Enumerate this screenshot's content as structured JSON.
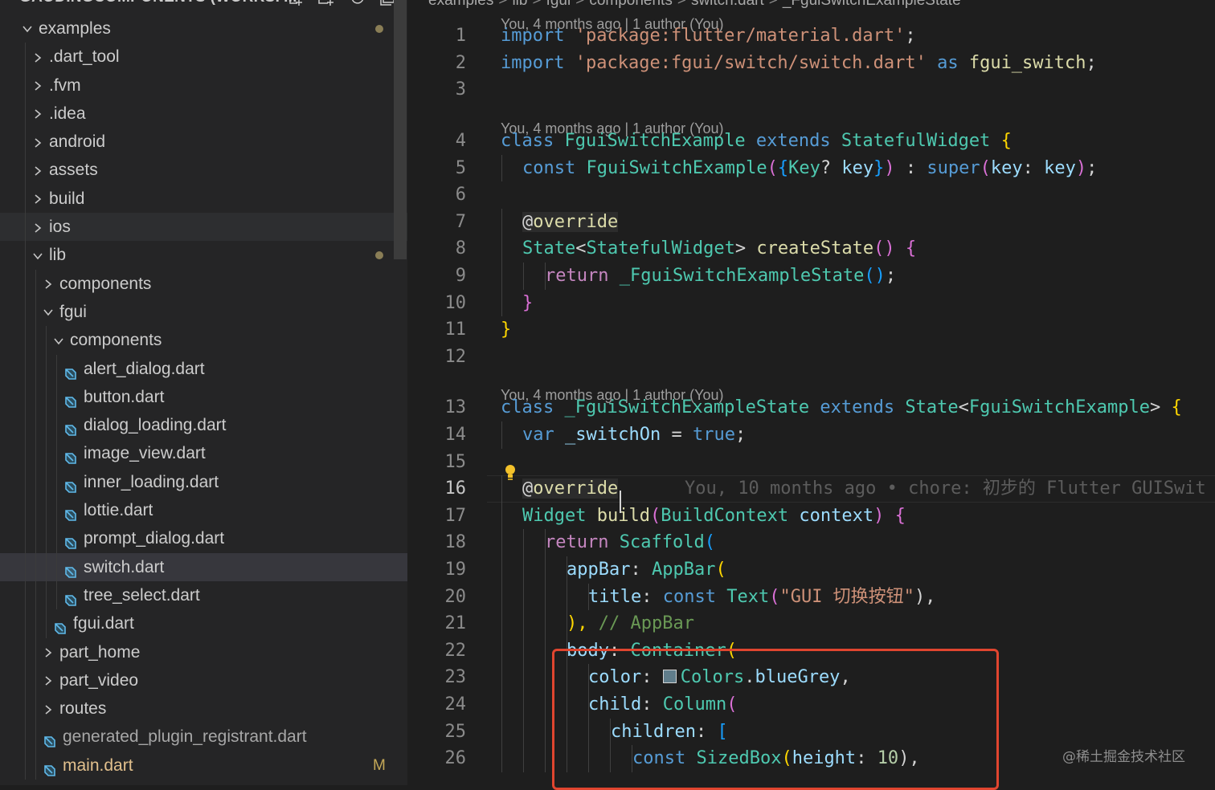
{
  "explorer": {
    "title": "GAODINGCOMPONENTS (WORKSP...",
    "header_icons": [
      "new-file-icon",
      "new-folder-icon",
      "refresh-icon",
      "collapse-all-icon"
    ],
    "tree": [
      {
        "label": "examples",
        "type": "folder",
        "expanded": true,
        "depth": 0,
        "dot": true
      },
      {
        "label": ".dart_tool",
        "type": "folder",
        "expanded": false,
        "depth": 1
      },
      {
        "label": ".fvm",
        "type": "folder",
        "expanded": false,
        "depth": 1
      },
      {
        "label": ".idea",
        "type": "folder",
        "expanded": false,
        "depth": 1
      },
      {
        "label": "android",
        "type": "folder",
        "expanded": false,
        "depth": 1
      },
      {
        "label": "assets",
        "type": "folder",
        "expanded": false,
        "depth": 1
      },
      {
        "label": "build",
        "type": "folder",
        "expanded": false,
        "depth": 1
      },
      {
        "label": "ios",
        "type": "folder",
        "expanded": false,
        "depth": 1
      },
      {
        "label": "lib",
        "type": "folder",
        "expanded": true,
        "depth": 1,
        "dot": true
      },
      {
        "label": "components",
        "type": "folder",
        "expanded": false,
        "depth": 2
      },
      {
        "label": "fgui",
        "type": "folder",
        "expanded": true,
        "depth": 2
      },
      {
        "label": "components",
        "type": "folder",
        "expanded": true,
        "depth": 3
      },
      {
        "label": "alert_dialog.dart",
        "type": "file",
        "depth": 4
      },
      {
        "label": "button.dart",
        "type": "file",
        "depth": 4
      },
      {
        "label": "dialog_loading.dart",
        "type": "file",
        "depth": 4
      },
      {
        "label": "image_view.dart",
        "type": "file",
        "depth": 4
      },
      {
        "label": "inner_loading.dart",
        "type": "file",
        "depth": 4
      },
      {
        "label": "lottie.dart",
        "type": "file",
        "depth": 4
      },
      {
        "label": "prompt_dialog.dart",
        "type": "file",
        "depth": 4
      },
      {
        "label": "switch.dart",
        "type": "file",
        "depth": 4,
        "selected": true
      },
      {
        "label": "tree_select.dart",
        "type": "file",
        "depth": 4
      },
      {
        "label": "fgui.dart",
        "type": "file",
        "depth": 3
      },
      {
        "label": "part_home",
        "type": "folder",
        "expanded": false,
        "depth": 2
      },
      {
        "label": "part_video",
        "type": "folder",
        "expanded": false,
        "depth": 2
      },
      {
        "label": "routes",
        "type": "folder",
        "expanded": false,
        "depth": 2
      },
      {
        "label": "generated_plugin_registrant.dart",
        "type": "file",
        "depth": 2,
        "dim": true
      },
      {
        "label": "main.dart",
        "type": "file",
        "depth": 2,
        "modified": true,
        "badge": "M"
      }
    ]
  },
  "breadcrumb": {
    "items": [
      "examples",
      "lib",
      "fgui",
      "components",
      "switch.dart",
      "_FguiSwitchExampleState"
    ],
    "separator": ">"
  },
  "codelens": {
    "line1": "You, 4 months ago | 1 author (You)",
    "line4": "You, 4 months ago | 1 author (You)",
    "line13": "You, 4 months ago | 1 author (You)"
  },
  "blame": {
    "line16": "You, 10 months ago • chore: 初步的 Flutter GUISwit"
  },
  "line_numbers": [
    "1",
    "2",
    "3",
    "4",
    "5",
    "6",
    "7",
    "8",
    "9",
    "10",
    "11",
    "12",
    "13",
    "14",
    "15",
    "16",
    "17",
    "18",
    "19",
    "20",
    "21",
    "22",
    "23",
    "24",
    "25",
    "26"
  ],
  "active_line": "16",
  "code": {
    "l1": [
      "import",
      " ",
      "'package:flutter/material.dart'",
      ";"
    ],
    "l2": [
      "import",
      " ",
      "'package:fgui/switch/switch.dart'",
      " ",
      "as",
      " ",
      "fgui_switch",
      ";"
    ],
    "l4": [
      "class",
      " ",
      "FguiSwitchExample",
      " ",
      "extends",
      " ",
      "StatefulWidget",
      " ",
      "{"
    ],
    "l5": [
      "const",
      " ",
      "FguiSwitchExample",
      "(",
      "{",
      "Key",
      "? ",
      "key",
      "}",
      ")",
      " : ",
      "super",
      "(",
      "key",
      ": ",
      "key",
      ")",
      ";"
    ],
    "l7": [
      "@override"
    ],
    "l8": [
      "State",
      "<",
      "StatefulWidget",
      "> ",
      "createState",
      "()",
      " ",
      "{"
    ],
    "l9": [
      "return",
      " ",
      "_FguiSwitchExampleState",
      "()",
      ";"
    ],
    "l10": [
      "}"
    ],
    "l11": [
      "}"
    ],
    "l13": [
      "class",
      " ",
      "_FguiSwitchExampleState",
      " ",
      "extends",
      " ",
      "State",
      "<",
      "FguiSwitchExample",
      "> ",
      "{"
    ],
    "l14": [
      "var",
      " ",
      "_switchOn",
      " = ",
      "true",
      ";"
    ],
    "l16": [
      "@override"
    ],
    "l17": [
      "Widget",
      " ",
      "build",
      "(",
      "BuildContext",
      " ",
      "context",
      ")",
      " ",
      "{"
    ],
    "l18": [
      "return",
      " ",
      "Scaffold",
      "("
    ],
    "l19": [
      "appBar",
      ": ",
      "AppBar",
      "("
    ],
    "l20": [
      "title",
      ": ",
      "const",
      " ",
      "Text",
      "(",
      "\"GUI 切换按钮\"",
      "),"
    ],
    "l21": [
      "),",
      " ",
      "// AppBar"
    ],
    "l22": [
      "body",
      ": ",
      "Container",
      "("
    ],
    "l23": [
      "color",
      ": ",
      "Colors",
      ".",
      "blueGrey",
      ","
    ],
    "l24": [
      "child",
      ": ",
      "Column",
      "("
    ],
    "l25": [
      "children",
      ": ",
      "["
    ],
    "l26": [
      "const",
      " ",
      "SizedBox",
      "(",
      "height",
      ": ",
      "10",
      "),"
    ]
  },
  "colors": {
    "highlight_box": "#e0452f",
    "swatch_blueGrey": "#607d8b",
    "selection": "#37373d"
  },
  "watermark": "@稀土掘金技术社区"
}
